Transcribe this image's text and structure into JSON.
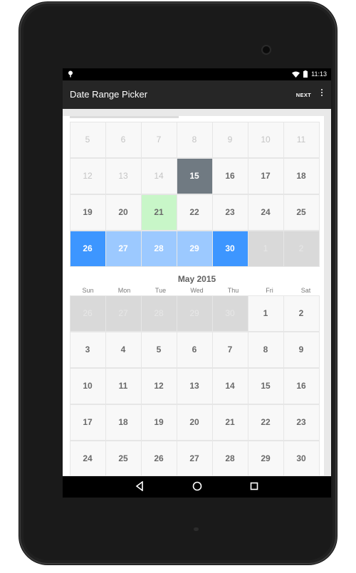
{
  "status": {
    "time": "11:13"
  },
  "app": {
    "title": "Date Range Picker",
    "next_label": "NEXT"
  },
  "april": {
    "weeks": [
      [
        {
          "d": "5",
          "s": "dim"
        },
        {
          "d": "6",
          "s": "dim"
        },
        {
          "d": "7",
          "s": "dim"
        },
        {
          "d": "8",
          "s": "dim"
        },
        {
          "d": "9",
          "s": "dim"
        },
        {
          "d": "10",
          "s": "dim"
        },
        {
          "d": "11",
          "s": "dim"
        }
      ],
      [
        {
          "d": "12",
          "s": "dim"
        },
        {
          "d": "13",
          "s": "dim"
        },
        {
          "d": "14",
          "s": "dim"
        },
        {
          "d": "15",
          "s": "today"
        },
        {
          "d": "16",
          "s": ""
        },
        {
          "d": "17",
          "s": ""
        },
        {
          "d": "18",
          "s": ""
        }
      ],
      [
        {
          "d": "19",
          "s": ""
        },
        {
          "d": "20",
          "s": ""
        },
        {
          "d": "21",
          "s": "green"
        },
        {
          "d": "22",
          "s": ""
        },
        {
          "d": "23",
          "s": ""
        },
        {
          "d": "24",
          "s": ""
        },
        {
          "d": "25",
          "s": ""
        }
      ],
      [
        {
          "d": "26",
          "s": "rangeend"
        },
        {
          "d": "27",
          "s": "rangemid"
        },
        {
          "d": "28",
          "s": "rangemid"
        },
        {
          "d": "29",
          "s": "rangemid"
        },
        {
          "d": "30",
          "s": "rangeend"
        },
        {
          "d": "1",
          "s": "disabled"
        },
        {
          "d": "2",
          "s": "disabled"
        }
      ]
    ]
  },
  "may": {
    "title": "May 2015",
    "dow": [
      "Sun",
      "Mon",
      "Tue",
      "Wed",
      "Thu",
      "Fri",
      "Sat"
    ],
    "weeks": [
      [
        {
          "d": "26",
          "s": "disabled"
        },
        {
          "d": "27",
          "s": "disabled"
        },
        {
          "d": "28",
          "s": "disabled"
        },
        {
          "d": "29",
          "s": "disabled"
        },
        {
          "d": "30",
          "s": "disabled"
        },
        {
          "d": "1",
          "s": ""
        },
        {
          "d": "2",
          "s": ""
        }
      ],
      [
        {
          "d": "3",
          "s": ""
        },
        {
          "d": "4",
          "s": ""
        },
        {
          "d": "5",
          "s": ""
        },
        {
          "d": "6",
          "s": ""
        },
        {
          "d": "7",
          "s": ""
        },
        {
          "d": "8",
          "s": ""
        },
        {
          "d": "9",
          "s": ""
        }
      ],
      [
        {
          "d": "10",
          "s": ""
        },
        {
          "d": "11",
          "s": ""
        },
        {
          "d": "12",
          "s": ""
        },
        {
          "d": "13",
          "s": ""
        },
        {
          "d": "14",
          "s": ""
        },
        {
          "d": "15",
          "s": ""
        },
        {
          "d": "16",
          "s": ""
        }
      ],
      [
        {
          "d": "17",
          "s": ""
        },
        {
          "d": "18",
          "s": ""
        },
        {
          "d": "19",
          "s": ""
        },
        {
          "d": "20",
          "s": ""
        },
        {
          "d": "21",
          "s": ""
        },
        {
          "d": "22",
          "s": ""
        },
        {
          "d": "23",
          "s": ""
        }
      ],
      [
        {
          "d": "24",
          "s": ""
        },
        {
          "d": "25",
          "s": ""
        },
        {
          "d": "26",
          "s": ""
        },
        {
          "d": "27",
          "s": ""
        },
        {
          "d": "28",
          "s": ""
        },
        {
          "d": "29",
          "s": ""
        },
        {
          "d": "30",
          "s": ""
        }
      ]
    ]
  },
  "colors": {
    "today": "#707a82",
    "range_end": "#3d96ff",
    "range_mid": "#9cc9ff",
    "highlight": "#c8f6c8",
    "disabled": "#d9d9d9"
  },
  "icons": {
    "back": "back-triangle-icon",
    "home": "home-circle-icon",
    "recents": "recents-square-icon",
    "wifi": "wifi-icon",
    "battery": "battery-icon",
    "pin": "location-pin-icon"
  }
}
